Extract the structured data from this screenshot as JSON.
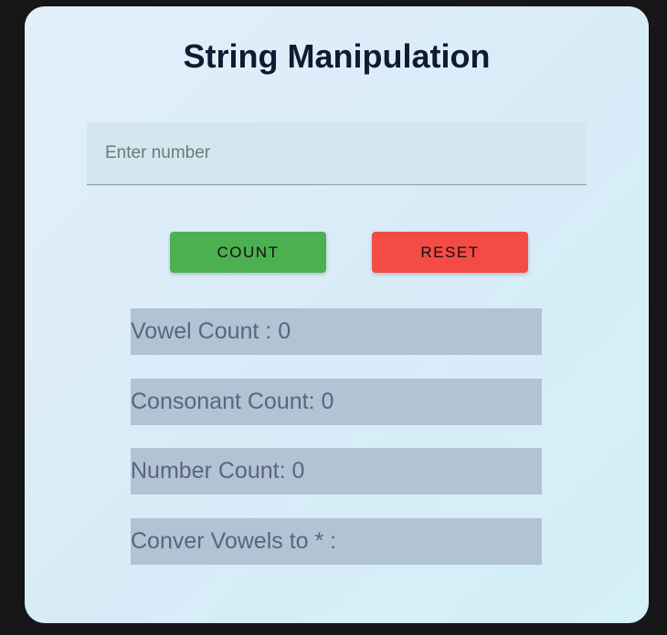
{
  "app": {
    "title": "String Manipulation"
  },
  "input": {
    "placeholder": "Enter number",
    "value": ""
  },
  "buttons": {
    "count_label": "COUNT",
    "reset_label": "RESET"
  },
  "results": {
    "vowel_label": "Vowel Count : ",
    "vowel_value": "0",
    "consonant_label": "Consonant Count: ",
    "consonant_value": "0",
    "number_label": "Number Count: ",
    "number_value": "0",
    "convert_label": "Conver Vowels to * : ",
    "convert_value": ""
  },
  "colors": {
    "count_button": "#4caf50",
    "reset_button": "#f44b45",
    "result_background": "#b2c3d3",
    "title": "#0f1b33"
  }
}
